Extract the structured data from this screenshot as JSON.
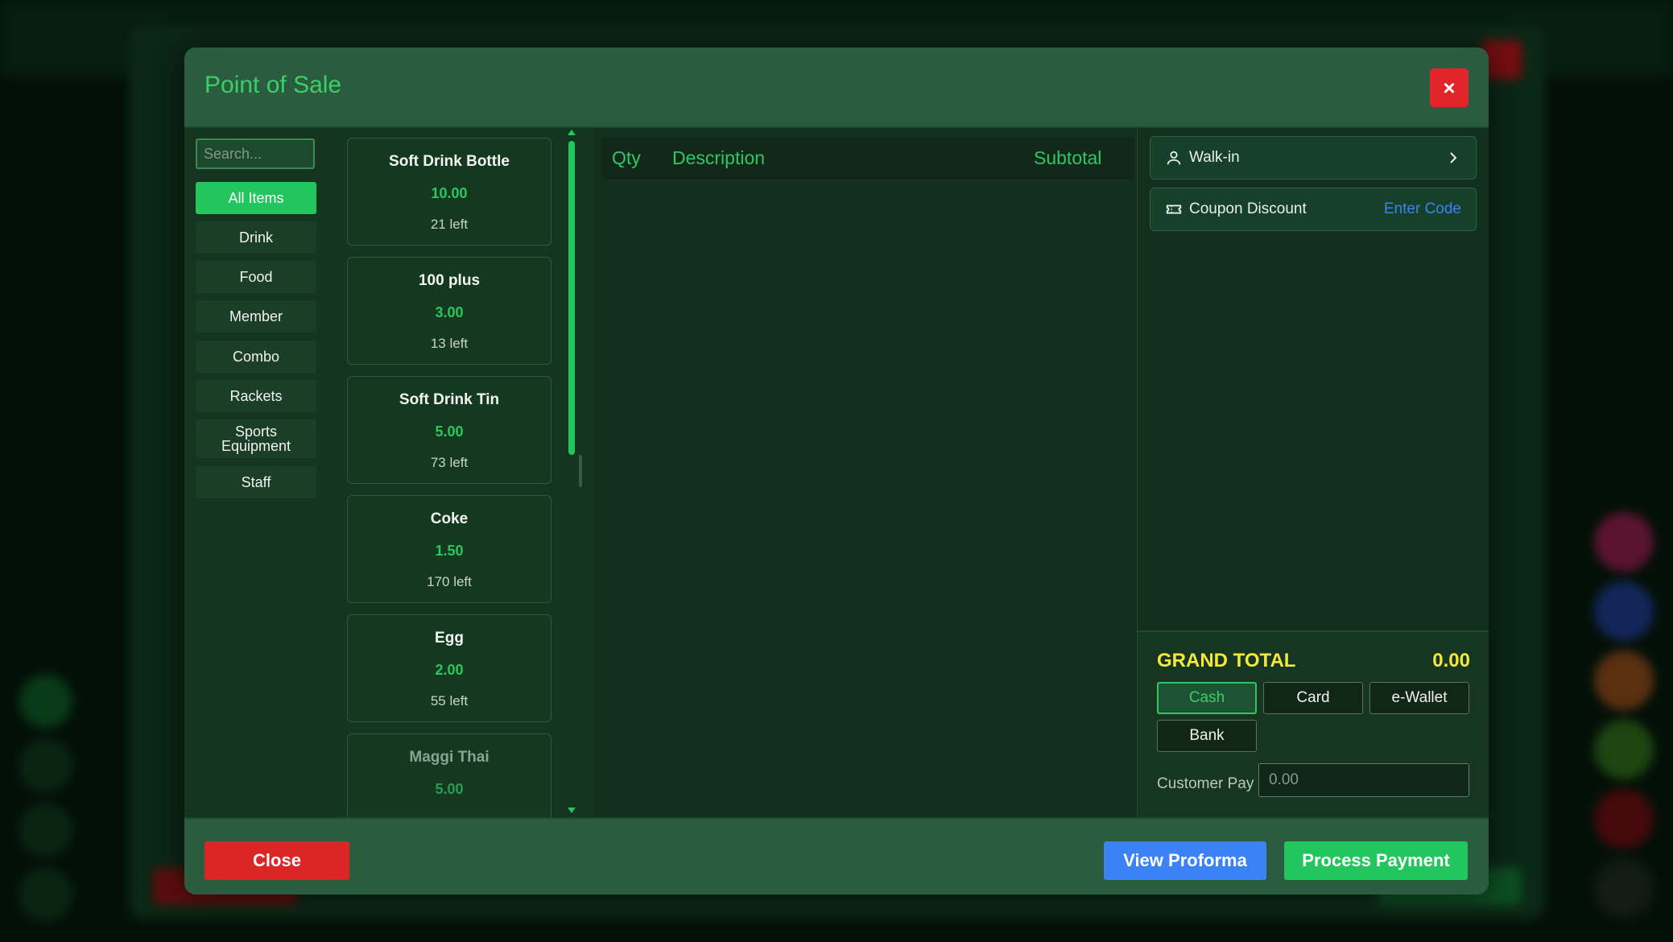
{
  "modal": {
    "title": "Point of Sale",
    "close_x": "×"
  },
  "search": {
    "placeholder": "Search..."
  },
  "categories": [
    {
      "label": "All Items",
      "active": true
    },
    {
      "label": "Drink"
    },
    {
      "label": "Food"
    },
    {
      "label": "Member"
    },
    {
      "label": "Combo"
    },
    {
      "label": "Rackets"
    },
    {
      "label": "Sports Equipment"
    },
    {
      "label": "Staff"
    }
  ],
  "products": [
    {
      "name": "Soft Drink Bottle",
      "price": "10.00",
      "stock": "21 left"
    },
    {
      "name": "100 plus",
      "price": "3.00",
      "stock": "13 left"
    },
    {
      "name": "Soft Drink Tin",
      "price": "5.00",
      "stock": "73 left"
    },
    {
      "name": "Coke",
      "price": "1.50",
      "stock": "170 left"
    },
    {
      "name": "Egg",
      "price": "2.00",
      "stock": "55 left"
    },
    {
      "name": "Maggi Thai",
      "price": "5.00",
      "stock": ""
    }
  ],
  "cart": {
    "headers": {
      "qty": "Qty",
      "description": "Description",
      "subtotal": "Subtotal"
    }
  },
  "customer": {
    "label": "Walk-in",
    "icon": "user-icon"
  },
  "coupon": {
    "label": "Coupon Discount",
    "action": "Enter Code",
    "icon": "ticket-icon"
  },
  "totals": {
    "grand_total_label": "GRAND TOTAL",
    "grand_total_value": "0.00",
    "payment_methods": [
      {
        "label": "Cash",
        "active": true
      },
      {
        "label": "Card"
      },
      {
        "label": "e-Wallet"
      },
      {
        "label": "Bank"
      }
    ],
    "customer_pay_label": "Customer Pay",
    "customer_pay_placeholder": "0.00"
  },
  "footer": {
    "close_label": "Close",
    "proforma_label": "View Proforma",
    "process_label": "Process Payment"
  },
  "colors": {
    "accent_green": "#22c55e",
    "danger_red": "#e0242a",
    "info_blue": "#3b82f6",
    "total_yellow": "#f5e83a"
  }
}
